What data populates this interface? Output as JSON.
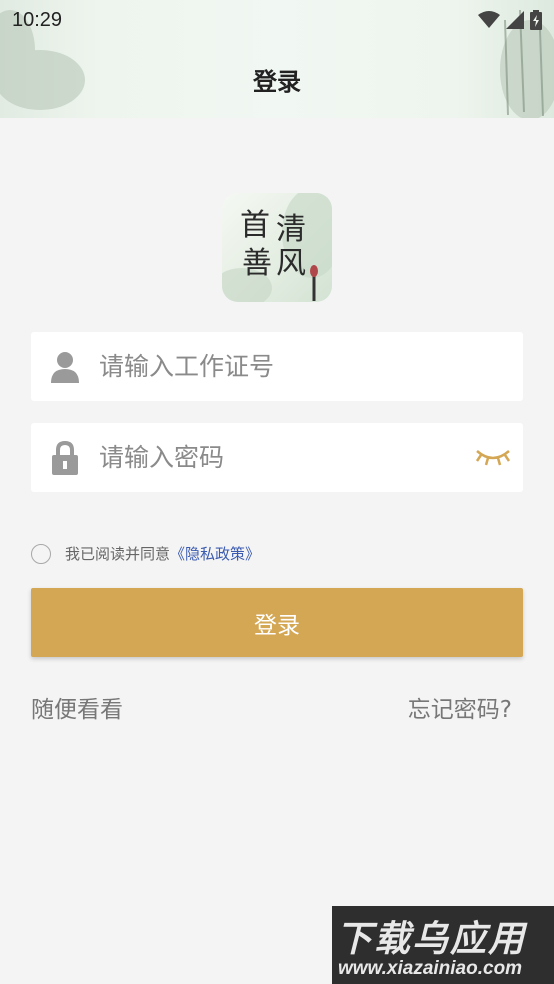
{
  "status_bar": {
    "time": "10:29"
  },
  "header": {
    "title": "登录"
  },
  "logo": {
    "chars": [
      "首",
      "清",
      "善",
      "风"
    ]
  },
  "form": {
    "id_placeholder": "请输入工作证号",
    "id_value": "",
    "password_placeholder": "请输入密码",
    "password_value": ""
  },
  "agreement": {
    "text": "我已阅读并同意",
    "policy_link": "《隐私政策》",
    "checked": false
  },
  "buttons": {
    "login": "登录"
  },
  "links": {
    "browse": "随便看看",
    "forgot_password": "忘记密码?"
  },
  "watermark": {
    "title": "下载乌应用",
    "url": "www.xiazainiao.com"
  },
  "colors": {
    "accent": "#d4a755",
    "link": "#3b5bb0",
    "background": "#f4f4f4"
  }
}
